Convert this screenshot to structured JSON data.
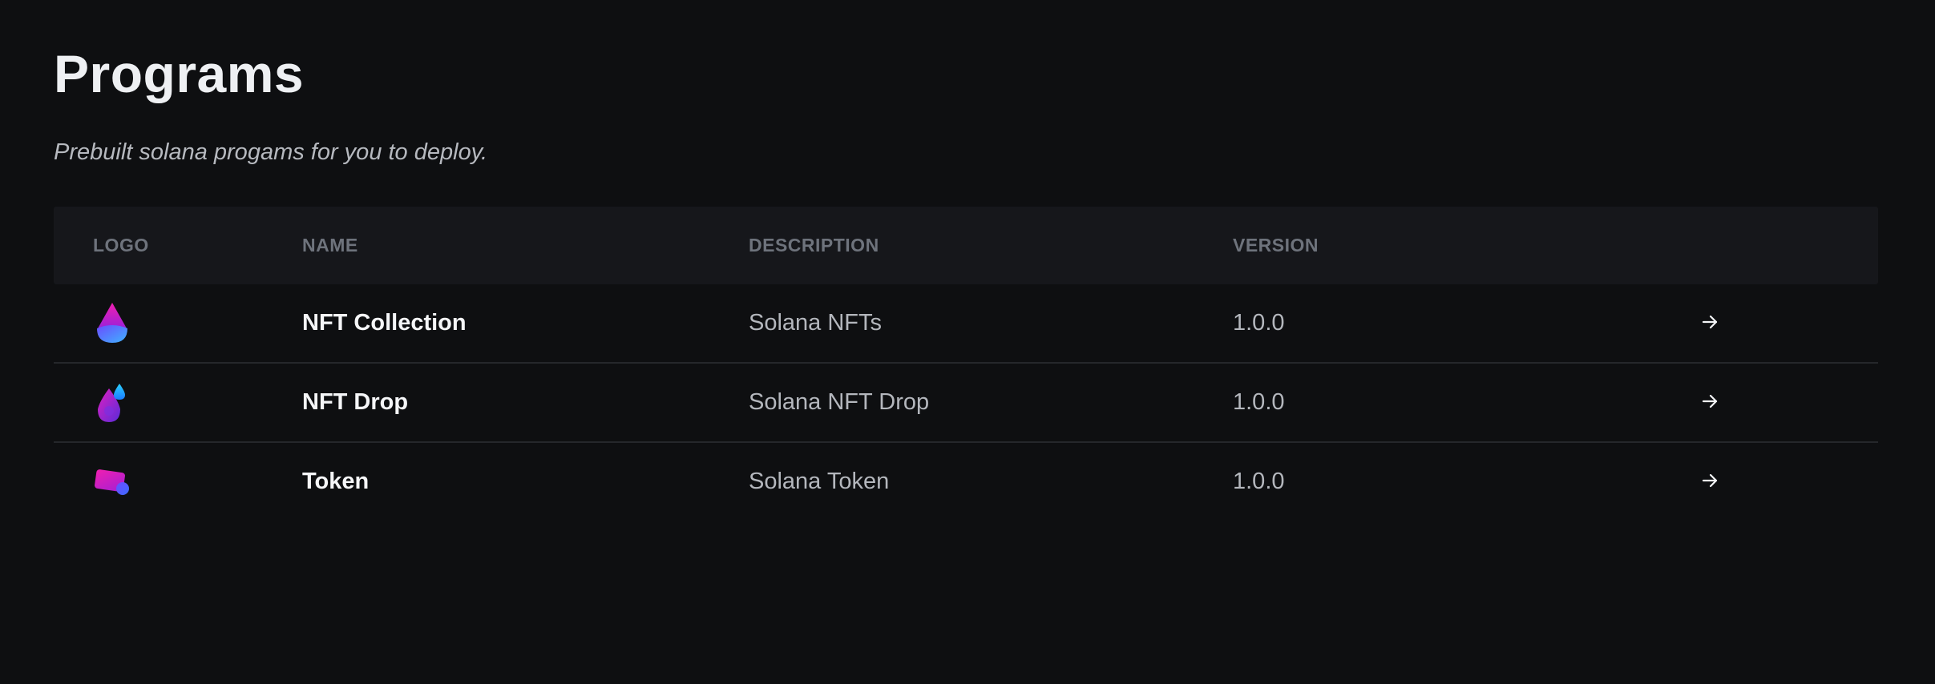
{
  "page": {
    "title": "Programs",
    "subtitle": "Prebuilt solana progams for you to deploy."
  },
  "table": {
    "headers": {
      "logo": "LOGO",
      "name": "NAME",
      "description": "DESCRIPTION",
      "version": "VERSION"
    },
    "rows": [
      {
        "logo_icon": "nft-collection-icon",
        "name": "NFT Collection",
        "description": "Solana NFTs",
        "version": "1.0.0",
        "action_icon": "arrow-right-icon"
      },
      {
        "logo_icon": "nft-drop-icon",
        "name": "NFT Drop",
        "description": "Solana NFT Drop",
        "version": "1.0.0",
        "action_icon": "arrow-right-icon"
      },
      {
        "logo_icon": "token-icon",
        "name": "Token",
        "description": "Solana Token",
        "version": "1.0.0",
        "action_icon": "arrow-right-icon"
      }
    ]
  },
  "colors": {
    "background": "#0e0f11",
    "header_background": "#16171b",
    "divider": "#25272b",
    "logo_pink": "#e11bb8",
    "logo_blue": "#3f8cff",
    "logo_purple": "#7b2be8"
  }
}
